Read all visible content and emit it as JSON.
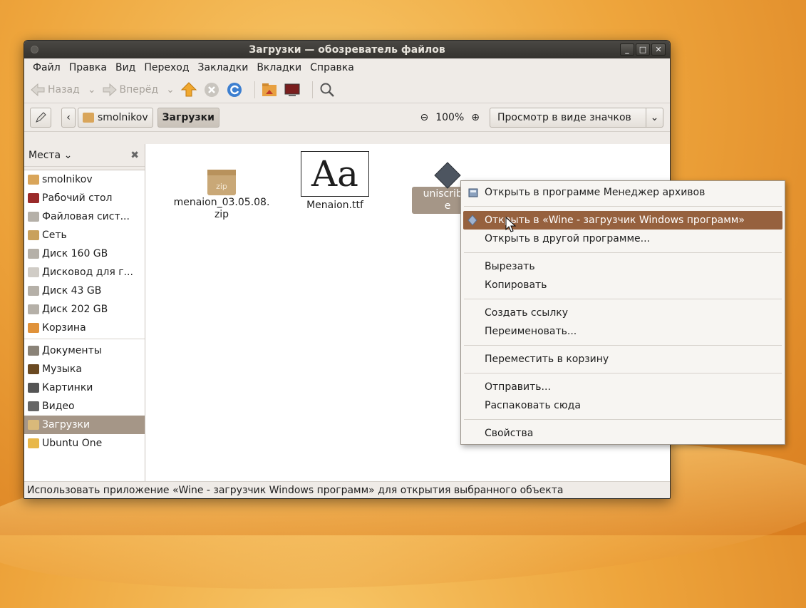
{
  "window": {
    "title": "Загрузки — обозреватель файлов",
    "buttons": [
      "_",
      "□",
      "✕"
    ]
  },
  "menubar": [
    "Файл",
    "Правка",
    "Вид",
    "Переход",
    "Закладки",
    "Вкладки",
    "Справка"
  ],
  "toolbar": {
    "back_label": "Назад",
    "forward_label": "Вперёд"
  },
  "location": {
    "crumbs": [
      "smolnikov",
      "Загрузки"
    ],
    "zoom_level": "100%",
    "view_mode": "Просмотр в виде значков"
  },
  "sidebar": {
    "header": "Места",
    "items": [
      {
        "label": "smolnikov",
        "icon": "home-folder-icon",
        "color": "#d9a55a"
      },
      {
        "label": "Рабочий стол",
        "icon": "desktop-icon",
        "color": "#9a2a2a"
      },
      {
        "label": "Файловая сист...",
        "icon": "filesystem-icon",
        "color": "#b5b0a8"
      },
      {
        "label": "Сеть",
        "icon": "network-icon",
        "color": "#c9a15c"
      },
      {
        "label": "Диск 160 GB",
        "icon": "drive-icon",
        "color": "#b5b0a8"
      },
      {
        "label": "Дисковод для г...",
        "icon": "floppy-drive-icon",
        "color": "#d0ccc6"
      },
      {
        "label": "Диск 43 GB",
        "icon": "drive-icon",
        "color": "#b5b0a8"
      },
      {
        "label": "Диск 202 GB",
        "icon": "drive-icon",
        "color": "#b5b0a8"
      },
      {
        "label": "Корзина",
        "icon": "trash-icon",
        "color": "#e0923a"
      }
    ],
    "bookmarks": [
      {
        "label": "Документы",
        "icon": "documents-folder-icon",
        "color": "#8a8378"
      },
      {
        "label": "Музыка",
        "icon": "music-folder-icon",
        "color": "#6b4a22"
      },
      {
        "label": "Картинки",
        "icon": "pictures-folder-icon",
        "color": "#555555"
      },
      {
        "label": "Видео",
        "icon": "video-folder-icon",
        "color": "#666666"
      },
      {
        "label": "Загрузки",
        "icon": "downloads-folder-icon",
        "color": "#d9b97a",
        "selected": true
      },
      {
        "label": "Ubuntu One",
        "icon": "ubuntu-one-folder-icon",
        "color": "#e8b84a"
      }
    ]
  },
  "files": [
    {
      "name": "menaion_03.05.08.\nzip",
      "icon": "zip-archive-icon",
      "badge": "zip"
    },
    {
      "name": "Menaion.ttf",
      "icon": "font-file-icon",
      "glyph": "Aa"
    },
    {
      "name": "uniscribe-\ne",
      "icon": "executable-icon"
    }
  ],
  "context_menu": [
    {
      "label": "Открыть в программе Менеджер архивов",
      "icon": "archive-manager-icon"
    },
    {
      "sep": true
    },
    {
      "label": "Открыть в «Wine - загрузчик Windows программ»",
      "icon": "wine-icon",
      "highlighted": true
    },
    {
      "label": "Открыть в другой программе..."
    },
    {
      "sep": true
    },
    {
      "label": "Вырезать"
    },
    {
      "label": "Копировать"
    },
    {
      "sep": true
    },
    {
      "label": "Создать ссылку"
    },
    {
      "label": "Переименовать..."
    },
    {
      "sep": true
    },
    {
      "label": "Переместить в корзину"
    },
    {
      "sep": true
    },
    {
      "label": "Отправить..."
    },
    {
      "label": "Распаковать сюда"
    },
    {
      "sep": true
    },
    {
      "label": "Свойства"
    }
  ],
  "statusbar": "Использовать приложение «Wine - загрузчик Windows программ» для открытия выбранного объекта",
  "colors": {
    "selection": "#a59687",
    "menu_highlight": "#96613e",
    "wallpaper": "#eea53c"
  }
}
